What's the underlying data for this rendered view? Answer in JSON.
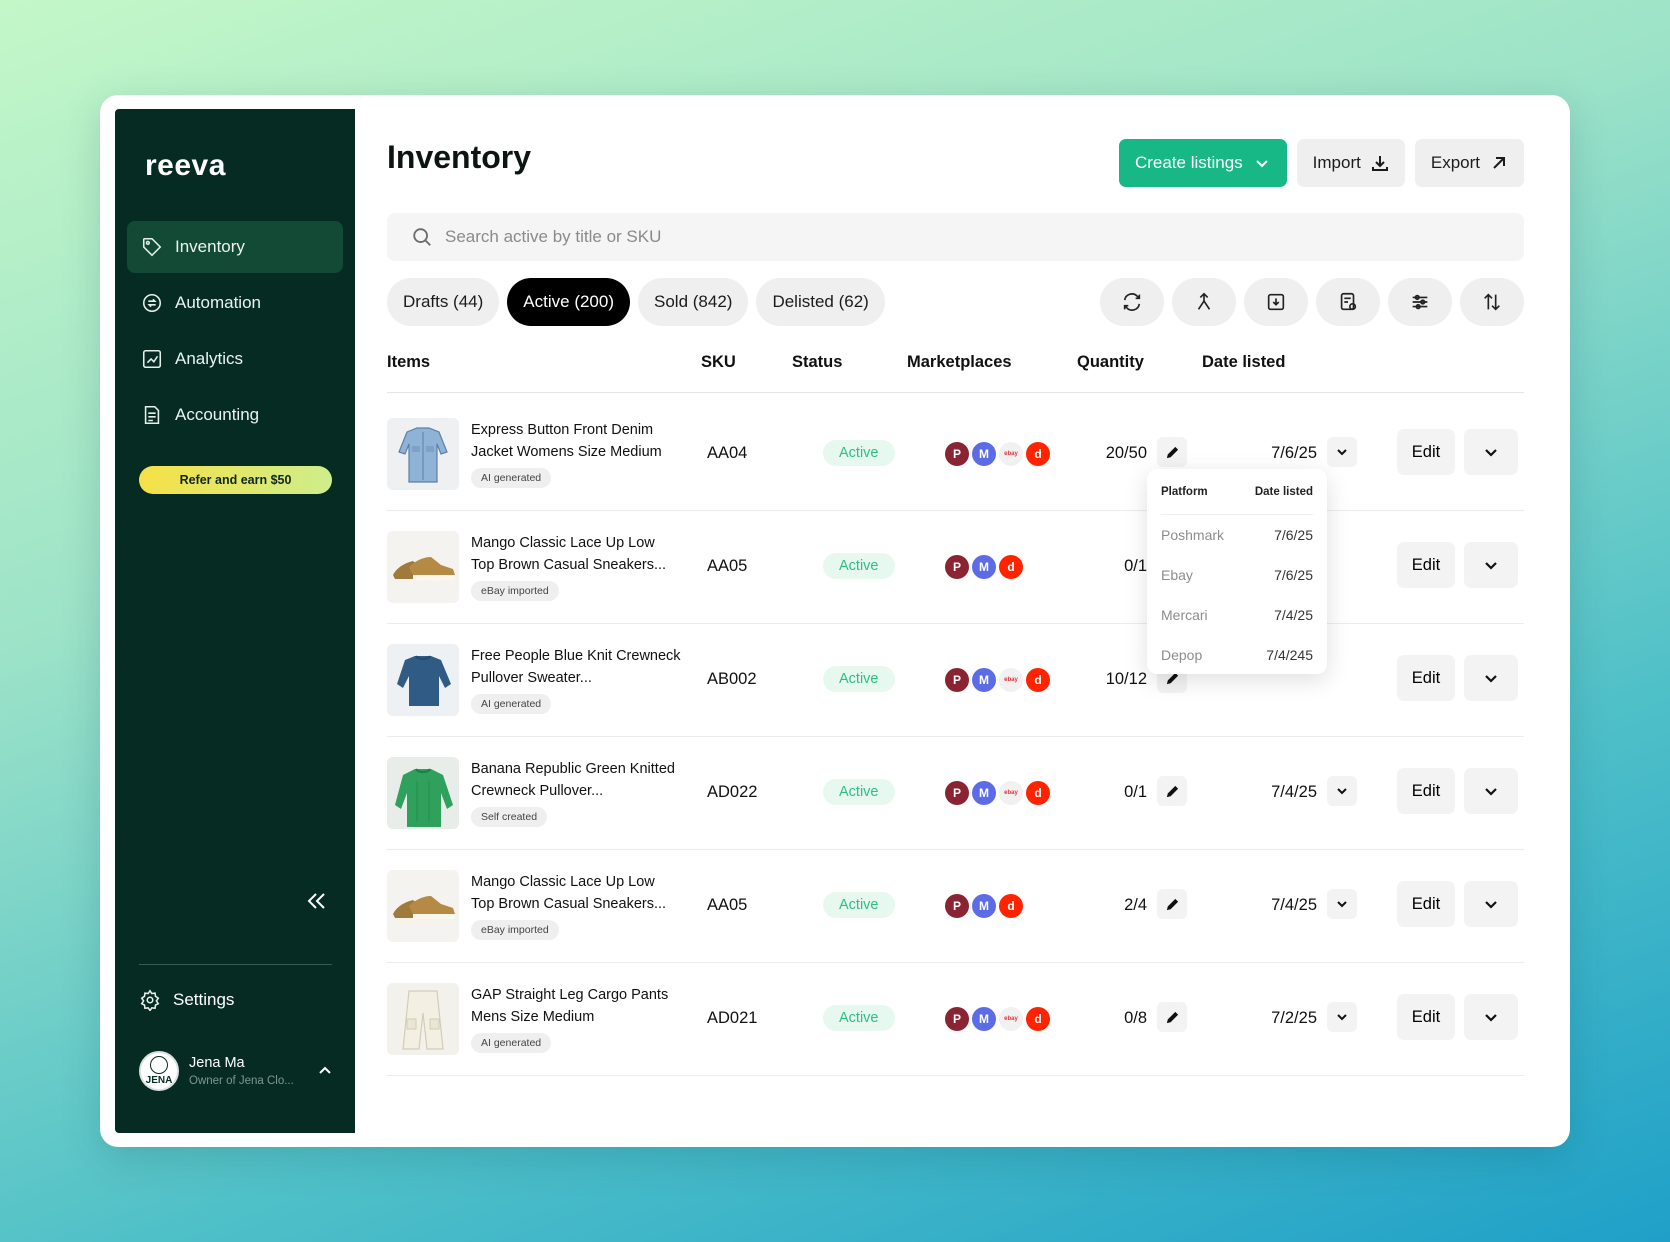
{
  "app": {
    "brand": "reeva"
  },
  "sidebar": {
    "items": [
      {
        "label": "Inventory",
        "icon": "tag-icon",
        "active": true
      },
      {
        "label": "Automation",
        "icon": "automation-icon",
        "active": false
      },
      {
        "label": "Analytics",
        "icon": "analytics-icon",
        "active": false
      },
      {
        "label": "Accounting",
        "icon": "document-icon",
        "active": false
      }
    ],
    "refer_label": "Refer and earn $50",
    "settings_label": "Settings",
    "user": {
      "name": "Jena Ma",
      "subtitle": "Owner of Jena Clo...",
      "avatar_text": "JENA"
    }
  },
  "header": {
    "title": "Inventory",
    "create_label": "Create listings",
    "import_label": "Import",
    "export_label": "Export"
  },
  "search": {
    "placeholder": "Search active by title or SKU",
    "value": ""
  },
  "tabs": [
    {
      "label": "Drafts (44)",
      "active": false
    },
    {
      "label": "Active (200)",
      "active": true
    },
    {
      "label": "Sold (842)",
      "active": false
    },
    {
      "label": "Delisted (62)",
      "active": false
    }
  ],
  "toolbar_icons": [
    "refresh-icon",
    "merge-icon",
    "download-icon",
    "report-icon",
    "filter-icon",
    "sort-icon"
  ],
  "table": {
    "columns": [
      "Items",
      "SKU",
      "Status",
      "Marketplaces",
      "Quantity",
      "Date listed"
    ],
    "edit_label": "Edit",
    "rows": [
      {
        "title": "Express Button Front Denim Jacket Womens Size Medium",
        "tag": "AI generated",
        "sku": "AA04",
        "status": "Active",
        "marketplaces": [
          "poshmark",
          "mercari",
          "ebay",
          "depop"
        ],
        "quantity": "20/50",
        "date": "7/6/25",
        "thumb": "denim-jacket"
      },
      {
        "title": "Mango Classic Lace Up Low Top Brown Casual Sneakers...",
        "tag": "eBay imported",
        "sku": "AA05",
        "status": "Active",
        "marketplaces": [
          "poshmark",
          "mercari",
          "depop"
        ],
        "quantity": "0/1",
        "date": "",
        "thumb": "sneakers"
      },
      {
        "title": "Free People Blue Knit Crewneck Pullover Sweater...",
        "tag": "AI generated",
        "sku": "AB002",
        "status": "Active",
        "marketplaces": [
          "poshmark",
          "mercari",
          "ebay",
          "depop"
        ],
        "quantity": "10/12",
        "date": "",
        "thumb": "blue-sweater"
      },
      {
        "title": "Banana Republic Green Knitted Crewneck Pullover...",
        "tag": "Self created",
        "sku": "AD022",
        "status": "Active",
        "marketplaces": [
          "poshmark",
          "mercari",
          "ebay",
          "depop"
        ],
        "quantity": "0/1",
        "date": "7/4/25",
        "thumb": "green-sweater"
      },
      {
        "title": "Mango Classic Lace Up Low Top Brown Casual Sneakers...",
        "tag": "eBay imported",
        "sku": "AA05",
        "status": "Active",
        "marketplaces": [
          "poshmark",
          "mercari",
          "depop"
        ],
        "quantity": "2/4",
        "date": "7/4/25",
        "thumb": "sneakers"
      },
      {
        "title": "GAP Straight Leg Cargo Pants Mens Size Medium",
        "tag": "AI generated",
        "sku": "AD021",
        "status": "Active",
        "marketplaces": [
          "poshmark",
          "mercari",
          "ebay",
          "depop"
        ],
        "quantity": "0/8",
        "date": "7/2/25",
        "thumb": "cargo-pants"
      }
    ]
  },
  "popover": {
    "header_platform": "Platform",
    "header_date": "Date listed",
    "rows": [
      {
        "platform": "Poshmark",
        "date": "7/6/25"
      },
      {
        "platform": "Ebay",
        "date": "7/6/25"
      },
      {
        "platform": "Mercari",
        "date": "7/4/25"
      },
      {
        "platform": "Depop",
        "date": "7/4/245"
      }
    ]
  },
  "colors": {
    "sidebar_bg": "#062b22",
    "primary": "#17b886",
    "active_status": "#2fbf83"
  }
}
